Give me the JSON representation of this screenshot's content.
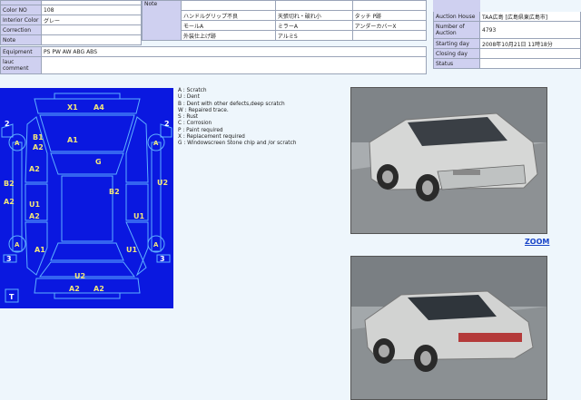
{
  "left_table": {
    "rows": [
      {
        "label": "Color NO",
        "value": "108"
      },
      {
        "label": "Interior Color",
        "value": "グレー"
      },
      {
        "label": "Correction",
        "value": ""
      },
      {
        "label": "Note",
        "value": ""
      },
      {
        "label": "Equipment",
        "value": "PS PW AW ABG ABS"
      },
      {
        "label": "lauc comment",
        "value": ""
      }
    ]
  },
  "note_table": {
    "label": "Note",
    "rows": [
      [
        "ハンドルグリップ不良",
        "天張切れ・破れ小",
        "タッチ P跡"
      ],
      [
        "モールA",
        "ミラーA",
        "アンダーカバーX"
      ],
      [
        "外装仕上げ跡",
        "アルミS",
        ""
      ]
    ]
  },
  "auction_table": {
    "rows": [
      {
        "label": "Auction House",
        "value": "TAA広島 [広島県東広島市]"
      },
      {
        "label": "Number of Auction",
        "value": "4793"
      },
      {
        "label": "Starting day",
        "value": "2008年10月21日 11時18分"
      },
      {
        "label": "Closing day",
        "value": ""
      },
      {
        "label": "Status",
        "value": ""
      }
    ]
  },
  "legend": [
    "A : Scratch",
    "U : Dent",
    "B : Dent with other defects,deep scratch",
    "W : Repaired trace.",
    "S : Rust",
    "C : Corrosion",
    "P : Paint required",
    "X : Replacement required",
    "G : Windowscreen Stone chip and /or scratch"
  ],
  "diagram_marks": [
    {
      "id": "x1",
      "text": "X1"
    },
    {
      "id": "a4",
      "text": "A4"
    },
    {
      "id": "n2l",
      "text": "2"
    },
    {
      "id": "n2r",
      "text": "2"
    },
    {
      "id": "b1",
      "text": "B1"
    },
    {
      "id": "a2fl",
      "text": "A2"
    },
    {
      "id": "a1h",
      "text": "A1"
    },
    {
      "id": "g",
      "text": "G"
    },
    {
      "id": "a2l",
      "text": "A2"
    },
    {
      "id": "b2l",
      "text": "B2"
    },
    {
      "id": "b2c",
      "text": "B2"
    },
    {
      "id": "u2r",
      "text": "U2"
    },
    {
      "id": "a2side",
      "text": "A2"
    },
    {
      "id": "u1l",
      "text": "U1"
    },
    {
      "id": "a2l2",
      "text": "A2"
    },
    {
      "id": "u1r",
      "text": "U1"
    },
    {
      "id": "a1l",
      "text": "A1"
    },
    {
      "id": "u1rr",
      "text": "U1"
    },
    {
      "id": "n3l",
      "text": "3"
    },
    {
      "id": "n3r",
      "text": "3"
    },
    {
      "id": "u2b",
      "text": "U2"
    },
    {
      "id": "a2b1",
      "text": "A2"
    },
    {
      "id": "a2b2",
      "text": "A2"
    },
    {
      "id": "t",
      "text": "T"
    },
    {
      "id": "wl1",
      "text": "A"
    },
    {
      "id": "wr1",
      "text": "A"
    },
    {
      "id": "wl2",
      "text": "A"
    },
    {
      "id": "wr2",
      "text": "A"
    }
  ],
  "zoom_label": "ZOOM",
  "colors": {
    "diagram_bg": "#0a18e0",
    "diagram_line": "#5fb0ff",
    "mark": "#f2e67a",
    "label_bg": "#cfd0f0"
  }
}
